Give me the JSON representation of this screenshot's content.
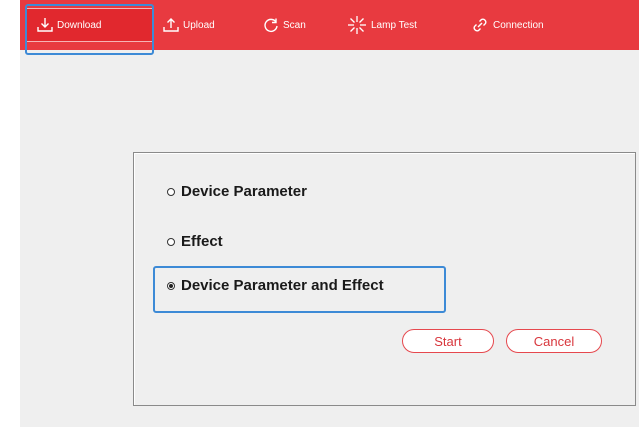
{
  "toolbar": {
    "items": [
      {
        "label": "Download",
        "icon": "download-icon"
      },
      {
        "label": "Upload",
        "icon": "upload-icon"
      },
      {
        "label": "Scan",
        "icon": "scan-icon"
      },
      {
        "label": "Lamp Test",
        "icon": "lamp-icon"
      },
      {
        "label": "Connection",
        "icon": "link-icon"
      }
    ]
  },
  "dialog": {
    "options": [
      {
        "label": "Device Parameter",
        "selected": false
      },
      {
        "label": "Effect",
        "selected": false
      },
      {
        "label": "Device Parameter and Effect",
        "selected": true
      }
    ],
    "start_label": "Start",
    "cancel_label": "Cancel"
  },
  "colors": {
    "toolbar": "#e83a40",
    "focus_outline": "#3d8ad6",
    "button_border": "#e6484e"
  }
}
